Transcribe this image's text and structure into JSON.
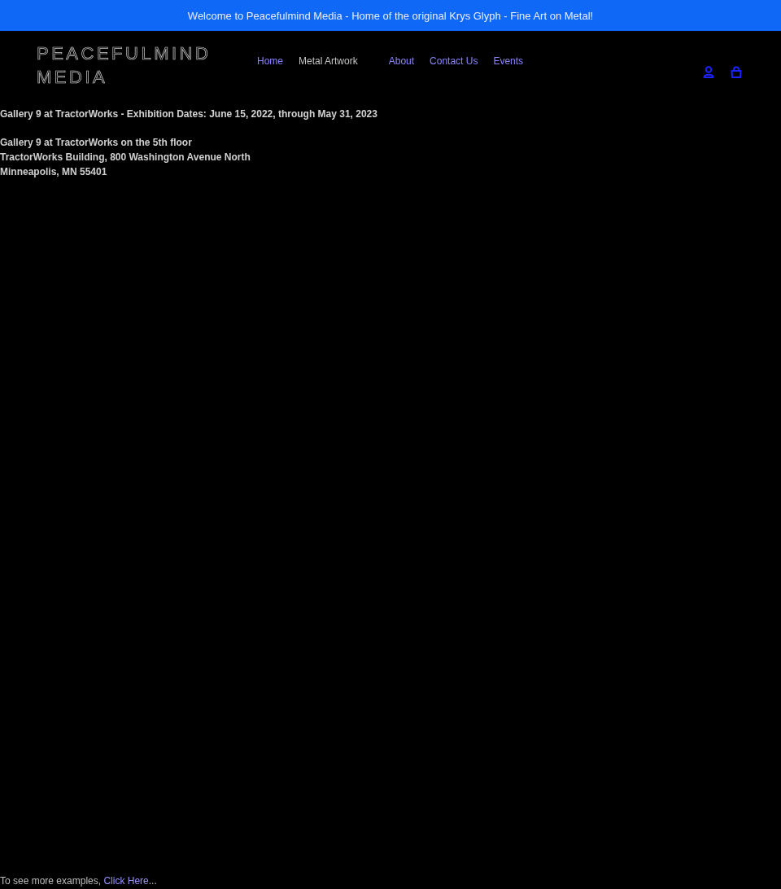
{
  "announcement": {
    "text": "Welcome to Peacefulmind Media - Home of the original Krys Glyph - Fine Art on Metal!"
  },
  "header": {
    "logo": "PEACEFULMIND MEDIA",
    "nav": [
      {
        "label": "Home",
        "kind": "link"
      },
      {
        "label": "Metal Artwork",
        "kind": "dropdown"
      },
      {
        "label": "About",
        "kind": "link"
      },
      {
        "label": "Contact Us",
        "kind": "link"
      },
      {
        "label": "Events",
        "kind": "link"
      }
    ]
  },
  "content": {
    "heading": "Gallery 9 at TractorWorks - Exhibition Dates: June 15, 2022, through May 31, 2023",
    "address_lines": [
      "Gallery 9 at TractorWorks on the 5th floor",
      "TractorWorks Building, 800 Washington Avenue North",
      "Minneapolis, MN 55401"
    ]
  },
  "footer": {
    "text": "To see more examples,",
    "link": "Click Here",
    "suffix": "..."
  }
}
